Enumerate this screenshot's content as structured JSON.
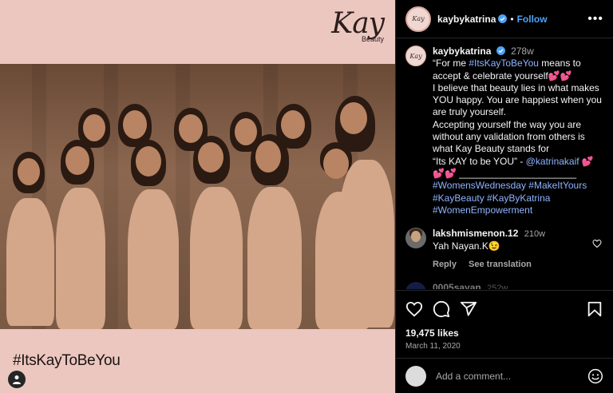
{
  "media": {
    "brand_name": "Kay",
    "brand_sub": "Beauty",
    "hashtag_text": "#ItsKayToBeYou"
  },
  "post": {
    "username": "kaybykatrina",
    "follow_label": "Follow",
    "more_label": "•••",
    "avatar_text": "Kay"
  },
  "caption": {
    "username": "kaybykatrina",
    "time": "278w",
    "line1_pre": "“For me ",
    "line1_tag": "#ItsKayToBeYou",
    "line1_post": " means to accept & celebrate yourself💕💕",
    "line2": "I believe that beauty lies in what makes YOU happy. You are happiest when you are truly yourself.",
    "line3": "Accepting yourself the way you are without any validation from others is what Kay Beauty stands for",
    "line4_pre": "“Its KAY to be YOU” - ",
    "line4_mention": "@katrinakaif",
    "line4_post": " 💕💕💕 ______________________",
    "tags": "#WomensWednesday #MakeItYours #KayBeauty #KayByKatrina #WomenEmpowerment"
  },
  "comments": [
    {
      "username": "lakshmismenon.12",
      "time": "210w",
      "text": "Yah Nayan.K😉",
      "reply_label": "Reply",
      "translate_label": "See translation"
    },
    {
      "username": "0005sayan",
      "time": "252w"
    }
  ],
  "actions": {
    "likes": "19,475 likes",
    "date": "March 11, 2020"
  },
  "add_comment": {
    "placeholder": "Add a comment..."
  },
  "colors": {
    "accent": "#4ca3f7",
    "hashtag_link": "#8fb3ff",
    "background": "#000000",
    "media_bg": "#ecc7c0"
  }
}
